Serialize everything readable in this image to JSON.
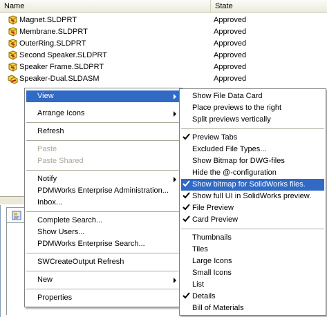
{
  "columns": {
    "name": "Name",
    "state": "State"
  },
  "files": [
    {
      "name": "Magnet.SLDPRT",
      "state": "Approved",
      "icon": "sldprt-part-icon"
    },
    {
      "name": "Membrane.SLDPRT",
      "state": "Approved",
      "icon": "sldprt-part-icon"
    },
    {
      "name": "OuterRing.SLDPRT",
      "state": "Approved",
      "icon": "sldprt-part-icon"
    },
    {
      "name": "Second Speaker.SLDPRT",
      "state": "Approved",
      "icon": "sldprt-part-icon"
    },
    {
      "name": "Speaker Frame.SLDPRT",
      "state": "Approved",
      "icon": "sldprt-part-icon"
    },
    {
      "name": "Speaker-Dual.SLDASM",
      "state": "Approved",
      "icon": "sldasm-assembly-icon"
    }
  ],
  "context_menu": {
    "view": "View",
    "arrange_icons": "Arrange Icons",
    "refresh": "Refresh",
    "paste": "Paste",
    "paste_shared": "Paste Shared",
    "notify": "Notify",
    "pdmworks_admin": "PDMWorks Enterprise Administration...",
    "inbox": "Inbox...",
    "complete_search": "Complete Search...",
    "show_users": "Show Users...",
    "pdmworks_search": "PDMWorks Enterprise Search...",
    "swcreateoutput_refresh": "SWCreateOutput Refresh",
    "new": "New",
    "properties": "Properties"
  },
  "view_submenu": {
    "show_file_data_card": "Show File Data Card",
    "place_previews_right": "Place previews to the right",
    "split_previews_vertically": "Split previews vertically",
    "preview_tabs": "Preview Tabs",
    "excluded_file_types": "Excluded File Types...",
    "show_bitmap_dwg": "Show Bitmap for DWG-files",
    "hide_configuration": "Hide the @-configuration",
    "show_bitmap_solidworks": "Show bitmap for SolidWorks files.",
    "show_full_ui": "Show full UI in SolidWorks preview.",
    "file_preview": "File Preview",
    "card_preview": "Card Preview",
    "thumbnails": "Thumbnails",
    "tiles": "Tiles",
    "large_icons": "Large Icons",
    "small_icons": "Small Icons",
    "list": "List",
    "details": "Details",
    "bill_of_materials": "Bill of Materials"
  },
  "colors": {
    "highlight": "#316ac5",
    "disabled": "#aca899",
    "header": "#ebeadb"
  }
}
